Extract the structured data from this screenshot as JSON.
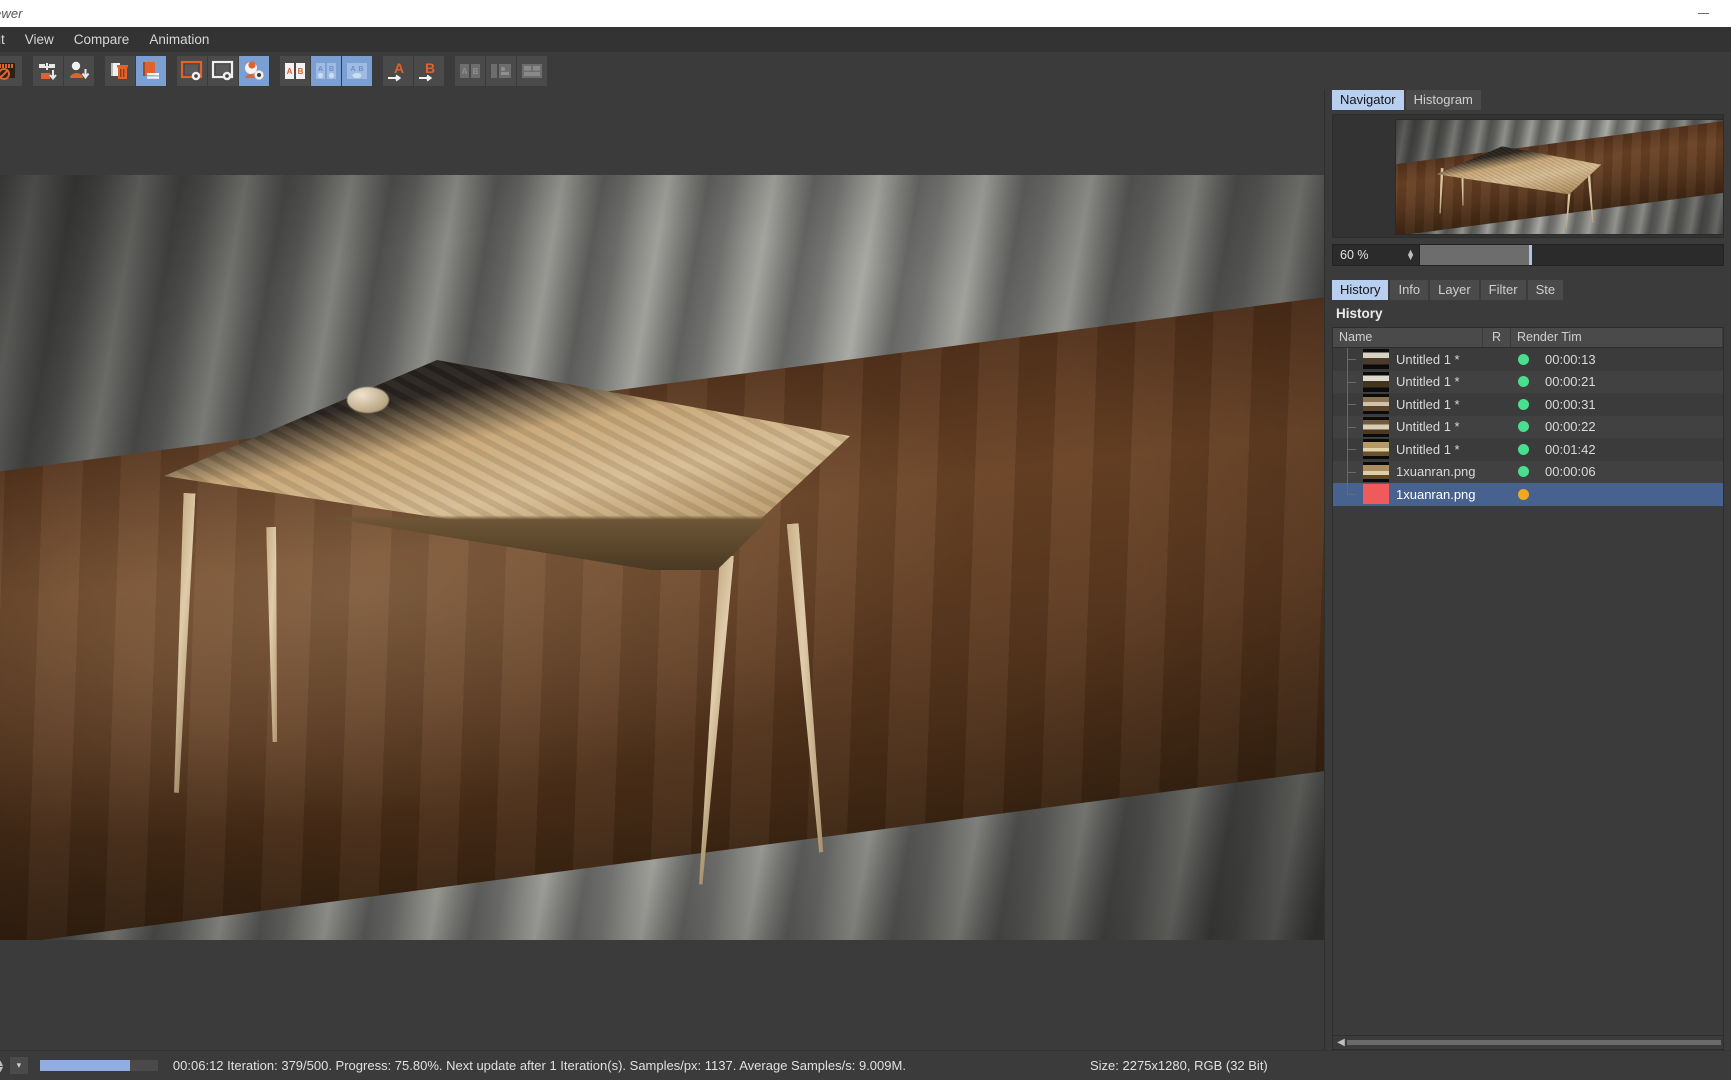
{
  "window": {
    "title": "ewer",
    "minimize_label": "minimize"
  },
  "menu": {
    "items": [
      {
        "label": "it"
      },
      {
        "label": "View"
      },
      {
        "label": "Compare"
      },
      {
        "label": "Animation"
      }
    ]
  },
  "toolbar": {
    "groups": [
      {
        "buttons": [
          {
            "name": "stop-render-button",
            "icon": "render-stop-icon",
            "selected": false
          }
        ]
      },
      {
        "buttons": [
          {
            "name": "save-all-images-button",
            "icon": "save-all-icon",
            "selected": false
          },
          {
            "name": "save-image-button",
            "icon": "save-image-icon",
            "selected": false
          }
        ]
      },
      {
        "buttons": [
          {
            "name": "clear-history-button",
            "icon": "trash-icon",
            "selected": false
          },
          {
            "name": "keep-image-button",
            "icon": "keep-image-icon",
            "selected": true
          }
        ]
      },
      {
        "buttons": [
          {
            "name": "view-a-button",
            "icon": "image-a-icon",
            "selected": false
          },
          {
            "name": "view-b-button",
            "icon": "image-b-icon",
            "selected": false
          },
          {
            "name": "view-ab-button",
            "icon": "image-ab-icon",
            "selected": true
          }
        ]
      },
      {
        "buttons": [
          {
            "name": "compare-side-by-side-button",
            "icon": "compare-ab-icon",
            "selected": false
          },
          {
            "name": "compare-difference-button",
            "icon": "compare-diff-icon",
            "selected": true
          },
          {
            "name": "compare-blend-button",
            "icon": "compare-blend-icon",
            "selected": true
          }
        ]
      },
      {
        "buttons": [
          {
            "name": "set-as-a-button",
            "icon": "set-a-icon",
            "selected": false
          },
          {
            "name": "set-as-b-button",
            "icon": "set-b-icon",
            "selected": false
          }
        ]
      },
      {
        "buttons": [
          {
            "name": "ab-compare-toggle-button",
            "icon": "ab-toggle-icon",
            "selected": false
          },
          {
            "name": "layout-split-button",
            "icon": "layout-split-icon",
            "selected": false
          },
          {
            "name": "layout-grid-button",
            "icon": "layout-grid-icon",
            "selected": false
          }
        ]
      }
    ]
  },
  "navigator": {
    "tabs": [
      {
        "label": "Navigator",
        "active": true
      },
      {
        "label": "Histogram",
        "active": false
      }
    ],
    "zoom_value": "60 %",
    "zoom_fill_percent": 36
  },
  "history": {
    "tabs": [
      {
        "label": "History",
        "active": true
      },
      {
        "label": "Info",
        "active": false
      },
      {
        "label": "Layer",
        "active": false
      },
      {
        "label": "Filter",
        "active": false
      },
      {
        "label": "Ste",
        "active": false
      }
    ],
    "section_title": "History",
    "columns": [
      {
        "label": "Name"
      },
      {
        "label": "R"
      },
      {
        "label": "Render Tim"
      }
    ],
    "rows": [
      {
        "name": "Untitled 1 *",
        "status_color": "#4adf8e",
        "render_time": "00:00:13",
        "selected": false,
        "thumb": "dark"
      },
      {
        "name": "Untitled 1 *",
        "status_color": "#4adf8e",
        "render_time": "00:00:21",
        "selected": false,
        "thumb": "dark"
      },
      {
        "name": "Untitled 1 *",
        "status_color": "#4adf8e",
        "render_time": "00:00:31",
        "selected": false,
        "thumb": "wood"
      },
      {
        "name": "Untitled 1 *",
        "status_color": "#4adf8e",
        "render_time": "00:00:22",
        "selected": false,
        "thumb": "wood"
      },
      {
        "name": "Untitled 1 *",
        "status_color": "#4adf8e",
        "render_time": "00:01:42",
        "selected": false,
        "thumb": "tan"
      },
      {
        "name": "1xuanran.png",
        "status_color": "#4adf8e",
        "render_time": "00:00:06",
        "selected": false,
        "thumb": "tan"
      },
      {
        "name": "1xuanran.png",
        "status_color": "#f0a81e",
        "render_time": "",
        "selected": true,
        "thumb": "red"
      }
    ]
  },
  "status": {
    "progress_percent": 76,
    "message": "00:06:12 Iteration: 379/500. Progress: 75.80%. Next update after 1 Iteration(s). Samples/px: 1137. Average Samples/s: 9.009M.",
    "size_info": "Size: 2275x1280, RGB (32 Bit)",
    "dropdown_glyph": "▾"
  },
  "colors": {
    "accent_orange": "#e0622c",
    "selection_blue": "#b9cff0",
    "row_selection": "#47628f",
    "status_ok": "#4adf8e",
    "status_pending": "#f0a81e",
    "panel_bg": "#3b3b3b"
  }
}
